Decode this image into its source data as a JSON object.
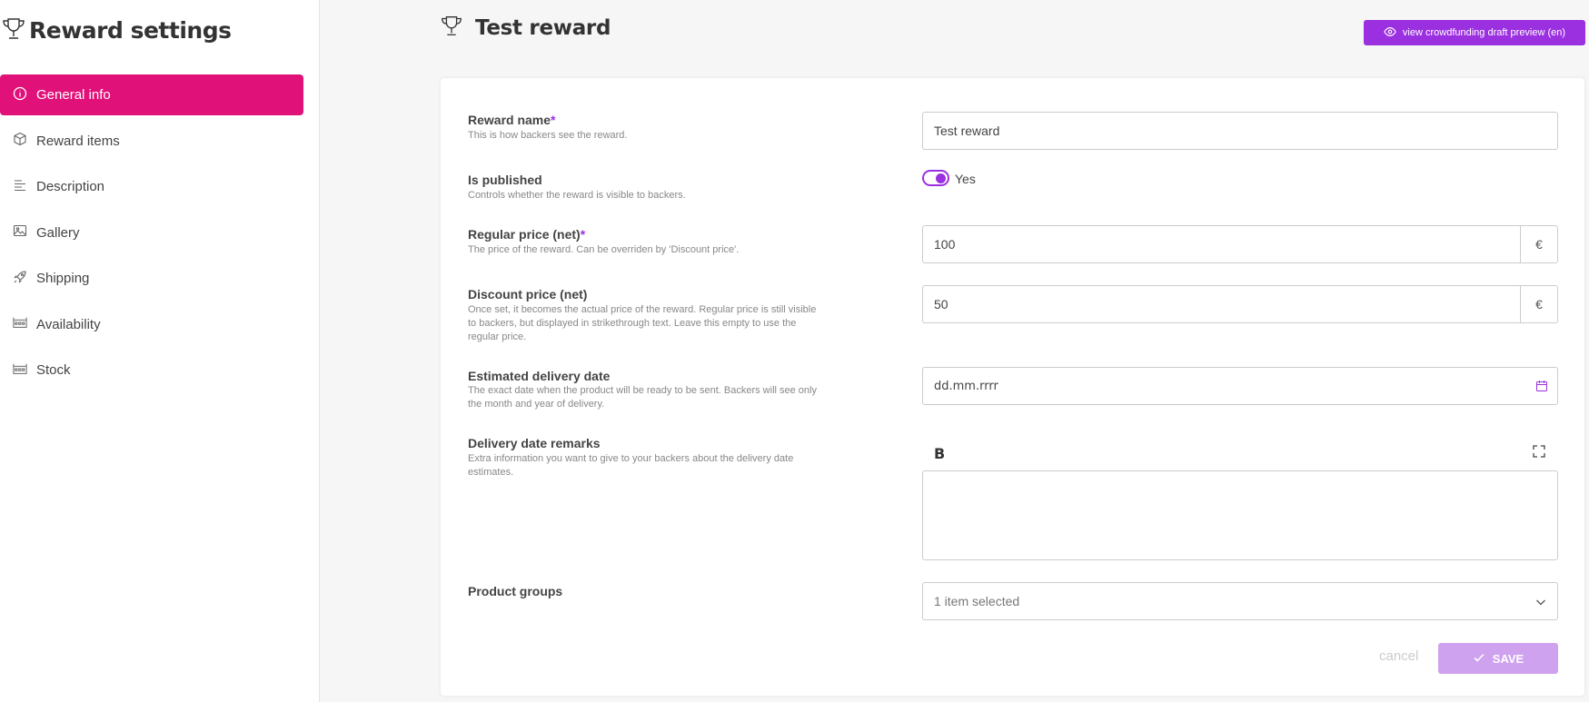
{
  "sidebar": {
    "title": "Reward settings",
    "title_icon": "trophy-icon",
    "items": [
      {
        "label": "General info",
        "icon": "info-icon",
        "active": true
      },
      {
        "label": "Reward items",
        "icon": "box-icon"
      },
      {
        "label": "Description",
        "icon": "text-lines-icon"
      },
      {
        "label": "Gallery",
        "icon": "image-icon"
      },
      {
        "label": "Shipping",
        "icon": "rocket-icon"
      },
      {
        "label": "Availability",
        "icon": "calendar-grid-icon"
      },
      {
        "label": "Stock",
        "icon": "calendar-grid-icon"
      }
    ]
  },
  "header": {
    "title": "Test reward",
    "preview_button": "view crowdfunding draft preview (en)"
  },
  "form": {
    "reward_name": {
      "label": "Reward name",
      "required": "*",
      "hint": "This is how backers see the reward.",
      "value": "Test reward"
    },
    "is_published": {
      "label": "Is published",
      "hint": "Controls whether the reward is visible to backers.",
      "toggle_label": "Yes",
      "on": true
    },
    "regular_price": {
      "label": "Regular price (net)",
      "required": "*",
      "hint": "The price of the reward. Can be overriden by 'Discount price'.",
      "value": "100",
      "currency": "€"
    },
    "discount_price": {
      "label": "Discount price (net)",
      "hint": "Once set, it becomes the actual price of the reward. Regular price is still visible to backers, but displayed in strikethrough text. Leave this empty to use the regular price.",
      "value": "50",
      "currency": "€"
    },
    "delivery_date": {
      "label": "Estimated delivery date",
      "hint": "The exact date when the product will be ready to be sent. Backers will see only the month and year of delivery.",
      "placeholder": "dd.mm.rrrr"
    },
    "delivery_remarks": {
      "label": "Delivery date remarks",
      "hint": "Extra information you want to give to your backers about the delivery date estimates.",
      "bold_button": "B",
      "value": ""
    },
    "product_groups": {
      "label": "Product groups",
      "value": "1 item selected"
    }
  },
  "actions": {
    "cancel": "cancel",
    "save": "SAVE"
  },
  "colors": {
    "active_nav": "#e1117a",
    "accent": "#9b30e0",
    "save_disabled": "#cfa2f0"
  }
}
